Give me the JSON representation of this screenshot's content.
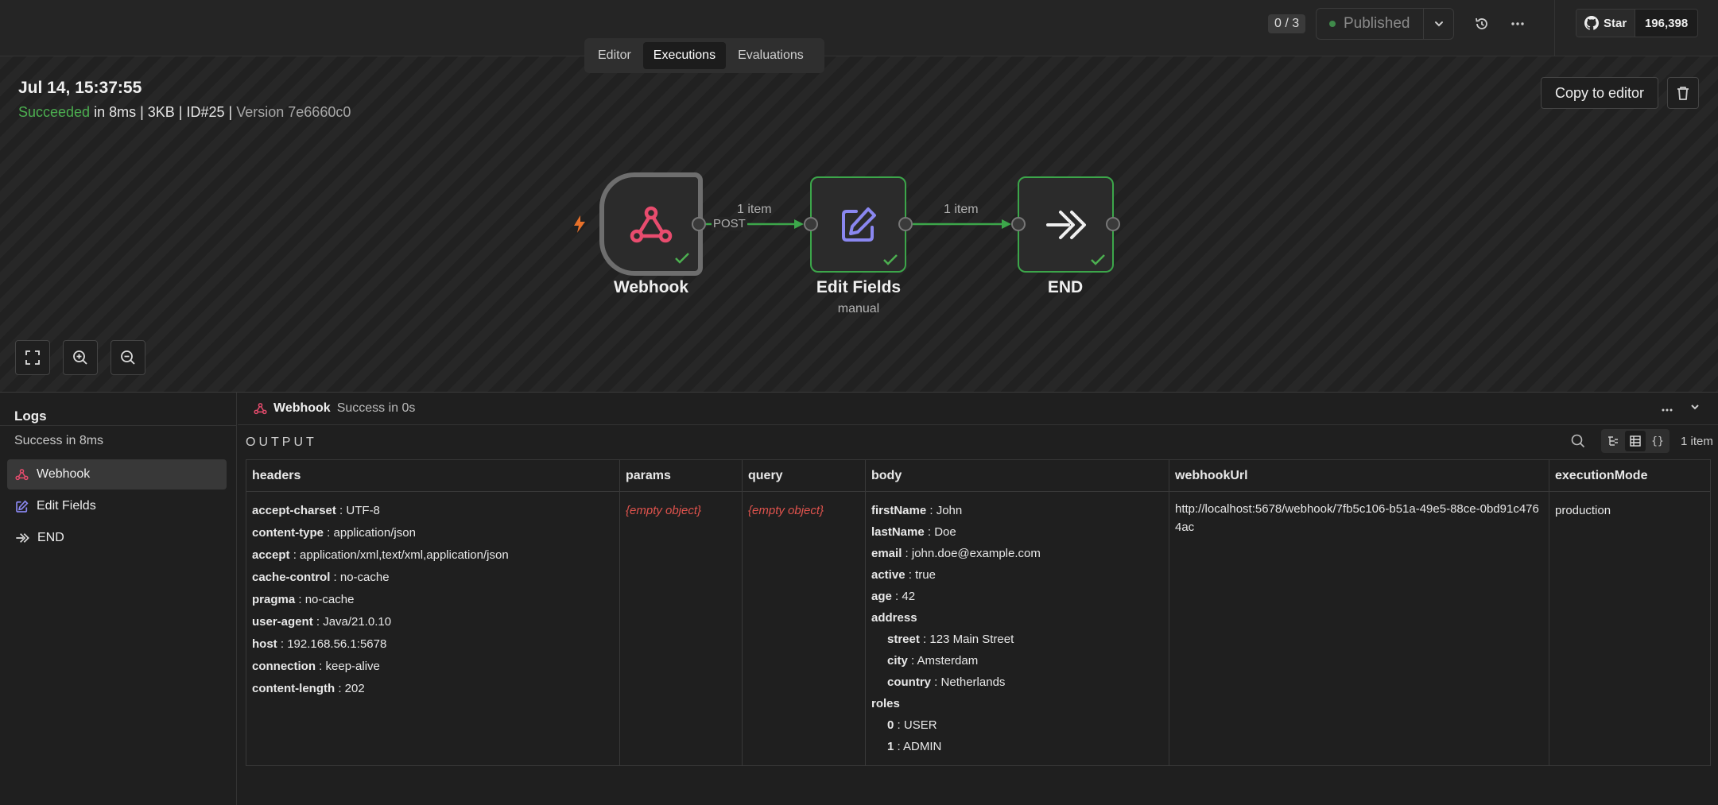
{
  "topbar": {
    "counter": "0 / 3",
    "status": "Published",
    "github_star": "Star",
    "github_count": "196,398"
  },
  "tabs": [
    {
      "label": "Editor"
    },
    {
      "label": "Executions"
    },
    {
      "label": "Evaluations"
    }
  ],
  "execution": {
    "date": "Jul 14, 15:37:55",
    "status": "Succeeded",
    "duration": " in 8ms",
    "size": " | 3KB | ",
    "id": "ID#25",
    "version_sep": " | ",
    "version": "Version 7e6660c0",
    "copy_label": "Copy to editor"
  },
  "canvas": {
    "nodes": [
      {
        "label": "Webhook",
        "sub": ""
      },
      {
        "label": "Edit Fields",
        "sub": "manual"
      },
      {
        "label": "END",
        "sub": ""
      }
    ],
    "connections": [
      {
        "label": "1 item",
        "sub": "POST"
      },
      {
        "label": "1 item"
      }
    ]
  },
  "logs": {
    "title": "Logs",
    "summary": "Success in 8ms",
    "items": [
      {
        "label": "Webhook"
      },
      {
        "label": "Edit Fields"
      },
      {
        "label": "END"
      }
    ]
  },
  "output": {
    "node_name": "Webhook",
    "node_status": "Success in 0s",
    "section_label": "OUTPUT",
    "item_count": "1 item",
    "columns": [
      "headers",
      "params",
      "query",
      "body",
      "webhookUrl",
      "executionMode"
    ],
    "headers": [
      {
        "k": "accept-charset",
        "v": "UTF-8"
      },
      {
        "k": "content-type",
        "v": "application/json"
      },
      {
        "k": "accept",
        "v": "application/xml,text/xml,application/json"
      },
      {
        "k": "cache-control",
        "v": "no-cache"
      },
      {
        "k": "pragma",
        "v": "no-cache"
      },
      {
        "k": "user-agent",
        "v": "Java/21.0.10"
      },
      {
        "k": "host",
        "v": "192.168.56.1:5678"
      },
      {
        "k": "connection",
        "v": "keep-alive"
      },
      {
        "k": "content-length",
        "v": "202"
      }
    ],
    "params": "{empty object}",
    "query": "{empty object}",
    "body": {
      "firstName": "John",
      "lastName": "Doe",
      "email": "john.doe@example.com",
      "active": "true",
      "age": "42",
      "address_label": "address",
      "street": "123 Main Street",
      "city": "Amsterdam",
      "country": "Netherlands",
      "roles_label": "roles",
      "role0": "USER",
      "role1": "ADMIN"
    },
    "webhookUrl": "http://localhost:5678/webhook/7fb5c106-b51a-49e5-88ce-0bd91c4764ac",
    "executionMode": "production"
  },
  "colors": {
    "success": "#4caf50",
    "webhook_icon": "#e84c6e",
    "edit_icon": "#8a87f0",
    "trigger": "#e8712a"
  }
}
